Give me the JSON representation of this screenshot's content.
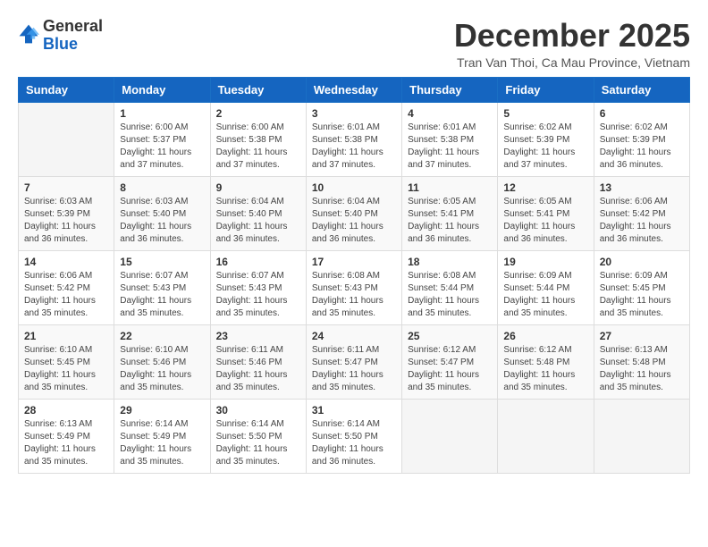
{
  "logo": {
    "general": "General",
    "blue": "Blue"
  },
  "header": {
    "month": "December 2025",
    "location": "Tran Van Thoi, Ca Mau Province, Vietnam"
  },
  "weekdays": [
    "Sunday",
    "Monday",
    "Tuesday",
    "Wednesday",
    "Thursday",
    "Friday",
    "Saturday"
  ],
  "weeks": [
    [
      {
        "day": "",
        "sunrise": "",
        "sunset": "",
        "daylight": ""
      },
      {
        "day": "1",
        "sunrise": "Sunrise: 6:00 AM",
        "sunset": "Sunset: 5:37 PM",
        "daylight": "Daylight: 11 hours and 37 minutes."
      },
      {
        "day": "2",
        "sunrise": "Sunrise: 6:00 AM",
        "sunset": "Sunset: 5:38 PM",
        "daylight": "Daylight: 11 hours and 37 minutes."
      },
      {
        "day": "3",
        "sunrise": "Sunrise: 6:01 AM",
        "sunset": "Sunset: 5:38 PM",
        "daylight": "Daylight: 11 hours and 37 minutes."
      },
      {
        "day": "4",
        "sunrise": "Sunrise: 6:01 AM",
        "sunset": "Sunset: 5:38 PM",
        "daylight": "Daylight: 11 hours and 37 minutes."
      },
      {
        "day": "5",
        "sunrise": "Sunrise: 6:02 AM",
        "sunset": "Sunset: 5:39 PM",
        "daylight": "Daylight: 11 hours and 37 minutes."
      },
      {
        "day": "6",
        "sunrise": "Sunrise: 6:02 AM",
        "sunset": "Sunset: 5:39 PM",
        "daylight": "Daylight: 11 hours and 36 minutes."
      }
    ],
    [
      {
        "day": "7",
        "sunrise": "Sunrise: 6:03 AM",
        "sunset": "Sunset: 5:39 PM",
        "daylight": "Daylight: 11 hours and 36 minutes."
      },
      {
        "day": "8",
        "sunrise": "Sunrise: 6:03 AM",
        "sunset": "Sunset: 5:40 PM",
        "daylight": "Daylight: 11 hours and 36 minutes."
      },
      {
        "day": "9",
        "sunrise": "Sunrise: 6:04 AM",
        "sunset": "Sunset: 5:40 PM",
        "daylight": "Daylight: 11 hours and 36 minutes."
      },
      {
        "day": "10",
        "sunrise": "Sunrise: 6:04 AM",
        "sunset": "Sunset: 5:40 PM",
        "daylight": "Daylight: 11 hours and 36 minutes."
      },
      {
        "day": "11",
        "sunrise": "Sunrise: 6:05 AM",
        "sunset": "Sunset: 5:41 PM",
        "daylight": "Daylight: 11 hours and 36 minutes."
      },
      {
        "day": "12",
        "sunrise": "Sunrise: 6:05 AM",
        "sunset": "Sunset: 5:41 PM",
        "daylight": "Daylight: 11 hours and 36 minutes."
      },
      {
        "day": "13",
        "sunrise": "Sunrise: 6:06 AM",
        "sunset": "Sunset: 5:42 PM",
        "daylight": "Daylight: 11 hours and 36 minutes."
      }
    ],
    [
      {
        "day": "14",
        "sunrise": "Sunrise: 6:06 AM",
        "sunset": "Sunset: 5:42 PM",
        "daylight": "Daylight: 11 hours and 35 minutes."
      },
      {
        "day": "15",
        "sunrise": "Sunrise: 6:07 AM",
        "sunset": "Sunset: 5:43 PM",
        "daylight": "Daylight: 11 hours and 35 minutes."
      },
      {
        "day": "16",
        "sunrise": "Sunrise: 6:07 AM",
        "sunset": "Sunset: 5:43 PM",
        "daylight": "Daylight: 11 hours and 35 minutes."
      },
      {
        "day": "17",
        "sunrise": "Sunrise: 6:08 AM",
        "sunset": "Sunset: 5:43 PM",
        "daylight": "Daylight: 11 hours and 35 minutes."
      },
      {
        "day": "18",
        "sunrise": "Sunrise: 6:08 AM",
        "sunset": "Sunset: 5:44 PM",
        "daylight": "Daylight: 11 hours and 35 minutes."
      },
      {
        "day": "19",
        "sunrise": "Sunrise: 6:09 AM",
        "sunset": "Sunset: 5:44 PM",
        "daylight": "Daylight: 11 hours and 35 minutes."
      },
      {
        "day": "20",
        "sunrise": "Sunrise: 6:09 AM",
        "sunset": "Sunset: 5:45 PM",
        "daylight": "Daylight: 11 hours and 35 minutes."
      }
    ],
    [
      {
        "day": "21",
        "sunrise": "Sunrise: 6:10 AM",
        "sunset": "Sunset: 5:45 PM",
        "daylight": "Daylight: 11 hours and 35 minutes."
      },
      {
        "day": "22",
        "sunrise": "Sunrise: 6:10 AM",
        "sunset": "Sunset: 5:46 PM",
        "daylight": "Daylight: 11 hours and 35 minutes."
      },
      {
        "day": "23",
        "sunrise": "Sunrise: 6:11 AM",
        "sunset": "Sunset: 5:46 PM",
        "daylight": "Daylight: 11 hours and 35 minutes."
      },
      {
        "day": "24",
        "sunrise": "Sunrise: 6:11 AM",
        "sunset": "Sunset: 5:47 PM",
        "daylight": "Daylight: 11 hours and 35 minutes."
      },
      {
        "day": "25",
        "sunrise": "Sunrise: 6:12 AM",
        "sunset": "Sunset: 5:47 PM",
        "daylight": "Daylight: 11 hours and 35 minutes."
      },
      {
        "day": "26",
        "sunrise": "Sunrise: 6:12 AM",
        "sunset": "Sunset: 5:48 PM",
        "daylight": "Daylight: 11 hours and 35 minutes."
      },
      {
        "day": "27",
        "sunrise": "Sunrise: 6:13 AM",
        "sunset": "Sunset: 5:48 PM",
        "daylight": "Daylight: 11 hours and 35 minutes."
      }
    ],
    [
      {
        "day": "28",
        "sunrise": "Sunrise: 6:13 AM",
        "sunset": "Sunset: 5:49 PM",
        "daylight": "Daylight: 11 hours and 35 minutes."
      },
      {
        "day": "29",
        "sunrise": "Sunrise: 6:14 AM",
        "sunset": "Sunset: 5:49 PM",
        "daylight": "Daylight: 11 hours and 35 minutes."
      },
      {
        "day": "30",
        "sunrise": "Sunrise: 6:14 AM",
        "sunset": "Sunset: 5:50 PM",
        "daylight": "Daylight: 11 hours and 35 minutes."
      },
      {
        "day": "31",
        "sunrise": "Sunrise: 6:14 AM",
        "sunset": "Sunset: 5:50 PM",
        "daylight": "Daylight: 11 hours and 36 minutes."
      },
      {
        "day": "",
        "sunrise": "",
        "sunset": "",
        "daylight": ""
      },
      {
        "day": "",
        "sunrise": "",
        "sunset": "",
        "daylight": ""
      },
      {
        "day": "",
        "sunrise": "",
        "sunset": "",
        "daylight": ""
      }
    ]
  ]
}
